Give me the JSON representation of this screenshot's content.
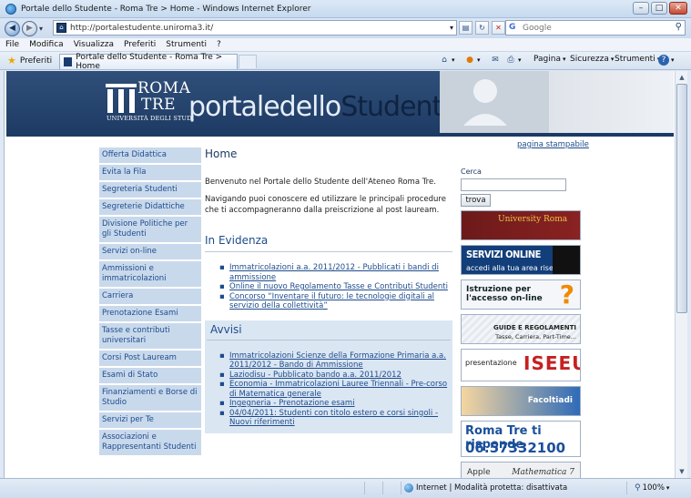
{
  "window": {
    "title": "Portale dello Studente - Roma Tre > Home - Windows Internet Explorer",
    "buttons": {
      "minimize": "–",
      "maximize": "□",
      "close": "✕"
    }
  },
  "address": {
    "url": "http://portalestudente.uniroma3.it/",
    "search_placeholder": "Google",
    "search_engine_icon": "g-icon"
  },
  "menu": [
    "File",
    "Modifica",
    "Visualizza",
    "Preferiti",
    "Strumenti",
    "?"
  ],
  "favorites": {
    "label": "Preferiti"
  },
  "tab": {
    "title": "Portale dello Studente - Roma Tre > Home"
  },
  "commands": {
    "pagina": "Pagina",
    "sicurezza": "Sicurezza",
    "strumenti": "Strumenti"
  },
  "banner": {
    "roma": "ROMA",
    "tre": "TRE",
    "univ": "UNIVERSITÀ DEGLI STUDI",
    "portale_part1": "portale",
    "portale_part2": "dello",
    "portale_part3": "Studente"
  },
  "nav": [
    "Offerta Didattica",
    "Evita la Fila",
    "Segreteria Studenti",
    "Segreterie Didattiche",
    "Divisione Politiche per gli Studenti",
    "Servizi on-line",
    "Ammissioni e immatricolazioni",
    "Carriera",
    "Prenotazione Esami",
    "Tasse e contributi universitari",
    "Corsi Post Lauream",
    "Esami di Stato",
    "Finanziamenti e Borse di Studio",
    "Servizi per Te",
    "Associazioni e Rappresentanti Studenti"
  ],
  "main": {
    "title": "Home",
    "intro1": "Benvenuto nel Portale dello Studente dell'Ateneo Roma Tre.",
    "intro2": "Navigando puoi conoscere ed utilizzare le principali procedure che ti accompagneranno dalla preiscrizione al post lauream.",
    "evidenza_title": "In Evidenza",
    "evidenza": [
      "Immatricolazioni a.a. 2011/2012 - Pubblicati i bandi di ammissione",
      "Online il nuovo Regolamento Tasse e Contributi Studenti",
      "Concorso “Inventare il futuro: le tecnologie digitali al servizio della collettività”"
    ],
    "avvisi_title": "Avvisi",
    "avvisi": [
      "Immatricolazioni Scienze della Formazione Primaria a.a. 2011/2012 - Bando di Ammissione",
      "Laziodisu - Pubblicato bando a.a. 2011/2012",
      "Economia - Immatricolazioni Lauree Triennali - Pre-corso di Matematica generale",
      "Ingegneria - Prenotazione esami",
      "04/04/2011: Studenti con titolo estero e corsi singoli - Nuovi riferimenti"
    ]
  },
  "right": {
    "stampa": "pagina stampabile",
    "cerca": "Cerca",
    "trova": "trova",
    "ads": {
      "ad1": "University Roma",
      "ad2_t1": "SERVIZI ONLINE",
      "ad2_t2": "accedi alla tua area riservata",
      "ad3_t1": "Istruzione per l'accesso on-line",
      "ad3_q": "?",
      "ad4_t1": "GUIDE E REGOLAMENTI",
      "ad4_t2": "Tasse, Carriera, Part-Time...",
      "ad5_t1": "presentazione",
      "ad5_t2": "ISEEU",
      "ad6_t1": "Facoltiadi",
      "ad7_t1": "Roma Tre ti risponde",
      "ad7_t2": "06.57332100",
      "ad8_t1": "Apple",
      "ad8_t2": "Mathematica 7"
    }
  },
  "status": {
    "zone": "Internet | Modalità protetta: disattivata",
    "zoom": "100%"
  },
  "colors": {
    "banner_bg": "#1d3a63",
    "nav_bg": "#c9d9ec",
    "link": "#1d4c8c",
    "avvisi_bg": "#dbe6f3"
  }
}
